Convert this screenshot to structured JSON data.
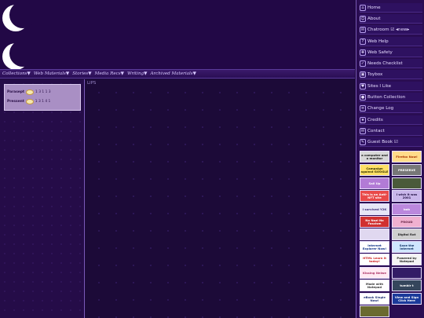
{
  "nav": {
    "items": [
      "Collections▼",
      "Web Materials▼",
      "Stories▼",
      "Media Recs▼",
      "Writing▼",
      "Archived Materials▼"
    ]
  },
  "pet": {
    "rows": [
      {
        "label": "Parasept",
        "value": "1 3 1 1 3"
      },
      {
        "label": "Pressent",
        "value": "1 3 1 4 1"
      }
    ]
  },
  "main": {
    "caption": "LIPS"
  },
  "sidebar": {
    "items": [
      {
        "label": "Home",
        "icon": "home-icon"
      },
      {
        "label": "About",
        "icon": "person-icon"
      },
      {
        "label": "Chatroom ☑ ◂new▸",
        "icon": "chat-icon"
      },
      {
        "label": "Web Help",
        "icon": "help-icon"
      },
      {
        "label": "Web Safety",
        "icon": "shield-icon"
      },
      {
        "label": "Needs Checklist",
        "icon": "checklist-icon"
      },
      {
        "label": "Toybox",
        "icon": "toybox-icon"
      },
      {
        "label": "Sites I Like",
        "icon": "heart-icon"
      },
      {
        "label": "Button Collection",
        "icon": "button-icon"
      },
      {
        "label": "Change Log",
        "icon": "log-icon"
      },
      {
        "label": "Credits",
        "icon": "credits-icon"
      },
      {
        "label": "Contact",
        "icon": "mail-icon"
      },
      {
        "label": "Guest Book ☑",
        "icon": "book-icon"
      }
    ],
    "buttons": [
      {
        "text": "a computer and a monitor",
        "bg": "#d8d8d8",
        "fg": "#111111"
      },
      {
        "text": "Firefox Now!",
        "bg": "#ffdc8a",
        "fg": "#aa3300"
      },
      {
        "text": "Campaign against GOOGLE",
        "bg": "#ffe066",
        "fg": "#333300"
      },
      {
        "text": "PRESERVE",
        "bg": "#777777",
        "fg": "#ffffff"
      },
      {
        "text": "Sail Up",
        "bg": "#b27bd6",
        "fg": "#ffffff"
      },
      {
        "text": "",
        "bg": "#4a5a3a",
        "fg": "#ffffff"
      },
      {
        "text": "This is an Anti-NFT site",
        "bg": "#e94a4a",
        "fg": "#ffffff"
      },
      {
        "text": "I wish it was 2001",
        "bg": "#c9b6ea",
        "fg": "#221144"
      },
      {
        "text": "I survived Y2K",
        "bg": "#e6e6f6",
        "fg": "#3a2a7a"
      },
      {
        "text": "bob",
        "bg": "#bb88dd",
        "fg": "#ffffff"
      },
      {
        "text": "No Nazi No Fascism",
        "bg": "#d03030",
        "fg": "#ffffff"
      },
      {
        "text": "PROUD",
        "bg": "#f0b0d0",
        "fg": "#662244"
      },
      {
        "text": "",
        "bg": "#e0d8f0",
        "fg": "#222222"
      },
      {
        "text": "Digital Rot",
        "bg": "#cfcfcf",
        "fg": "#222222"
      },
      {
        "text": "Internet Explorer Now!",
        "bg": "#ffffff",
        "fg": "#113388"
      },
      {
        "text": "Save the Internet",
        "bg": "#cfe6ff",
        "fg": "#113366"
      },
      {
        "text": "HTML Learn it today!",
        "bg": "#ffffff",
        "fg": "#cc2222"
      },
      {
        "text": "Powered by Notepad",
        "bg": "#f4f4f4",
        "fg": "#222222"
      },
      {
        "text": "Kissing Neiwe",
        "bg": "#ffe9f2",
        "fg": "#aa3366"
      },
      {
        "text": "",
        "bg": "#331c66",
        "fg": "#ffffff"
      },
      {
        "text": "Made with Notepad",
        "bg": "#ffffff",
        "fg": "#333333"
      },
      {
        "text": "tumblr t",
        "bg": "#35465c",
        "fg": "#ffffff"
      },
      {
        "text": "eBook Single Now!",
        "bg": "#ffffff",
        "fg": "#223377"
      },
      {
        "text": "View and Sign Click Here",
        "bg": "#1b3a9a",
        "fg": "#ffffff"
      },
      {
        "text": "",
        "bg": "#6a6a30",
        "fg": "#ffffff"
      }
    ]
  }
}
